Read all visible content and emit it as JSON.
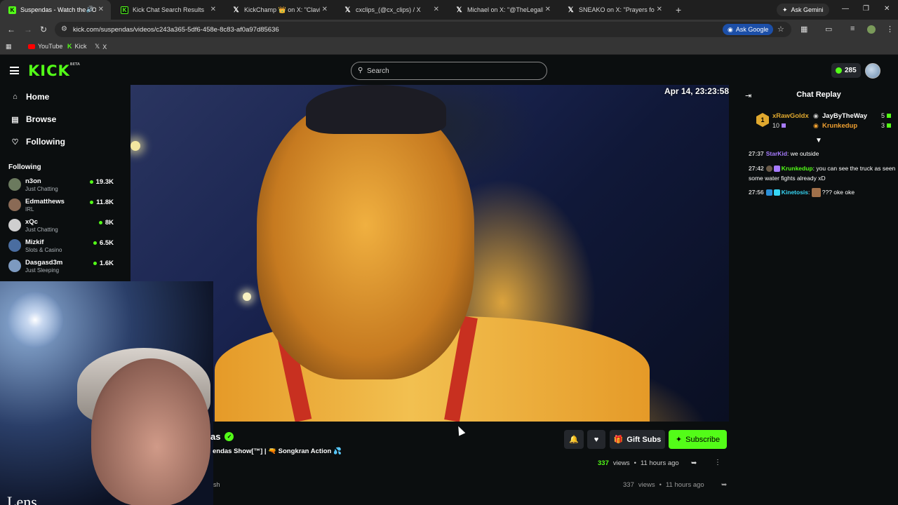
{
  "browser": {
    "tabs": [
      {
        "title": "Suspendas - Watch the VOD",
        "favicon": "kick",
        "active": true
      },
      {
        "title": "Kick Chat Search Results",
        "favicon": "kickdark",
        "active": false
      },
      {
        "title": "KickChamp 👑 on X: \"Clavicula...",
        "favicon": "x",
        "active": false
      },
      {
        "title": "cxclips_(@cx_clips) / X",
        "favicon": "x",
        "active": false
      },
      {
        "title": "Michael on X: \"@TheLegalMind...",
        "favicon": "x",
        "active": false
      },
      {
        "title": "SNEAKO on X: \"Prayers for Cla...",
        "favicon": "x",
        "active": false
      }
    ],
    "ask_gemini": "Ask Gemini",
    "url": "kick.com/suspendas/videos/c243a365-5df6-458e-8c83-af0a97d85636",
    "ask_google": "Ask Google",
    "bookmarks": [
      {
        "label": "YouTube",
        "icon": "youtube-icon"
      },
      {
        "label": "Kick",
        "icon": "kick-icon"
      },
      {
        "label": "X",
        "icon": "x-icon"
      }
    ]
  },
  "header": {
    "logo": "KICK",
    "logo_badge": "BETA",
    "search_placeholder": "Search",
    "points": "285"
  },
  "sidebar": {
    "nav": [
      {
        "label": "Home",
        "icon": "home-icon"
      },
      {
        "label": "Browse",
        "icon": "browse-icon"
      },
      {
        "label": "Following",
        "icon": "heart-icon"
      }
    ],
    "following_heading": "Following",
    "following": [
      {
        "name": "n3on",
        "category": "Just Chatting",
        "viewers": "19.3K",
        "avatar_color": "#6b7a5e"
      },
      {
        "name": "Edmatthews",
        "category": "IRL",
        "viewers": "11.8K",
        "avatar_color": "#8a6a55"
      },
      {
        "name": "xQc",
        "category": "Just Chatting",
        "viewers": "8K",
        "avatar_color": "#cfcfcf"
      },
      {
        "name": "Mizkif",
        "category": "Slots & Casino",
        "viewers": "6.5K",
        "avatar_color": "#4a6da0"
      },
      {
        "name": "Dasgasd3m",
        "category": "Just Sleeping",
        "viewers": "1.6K",
        "avatar_color": "#7d9ac0"
      }
    ]
  },
  "video": {
    "timestamp": "Apr 14, 23:23:58"
  },
  "webcam": {
    "caption": "Lens"
  },
  "stream_info": {
    "name_fragment": "as",
    "title": "endas Show[™] | 🔫 Songkran Action 💦",
    "faded_fragment": "sh",
    "gift_subs_label": "Gift Subs",
    "subscribe_label": "Subscribe",
    "views": "337",
    "views_label": "views",
    "time_ago": "11 hours ago"
  },
  "chat": {
    "title": "Chat Replay",
    "leaderboard": [
      {
        "rank": "1",
        "name": "xRawGoldx",
        "count": "10",
        "color": "#e0a82e"
      },
      {
        "name": "JayByTheWay",
        "count": "5",
        "color": "#ffffff"
      },
      {
        "name": "Krunkedup",
        "count": "3",
        "color": "#f0a030"
      }
    ],
    "messages": [
      {
        "time": "27:37",
        "user": "StarKid",
        "user_color": "#a77bff",
        "text": "we outside"
      },
      {
        "time": "27:42",
        "user": "Krunkedup",
        "user_color": "#53fc18",
        "text": "you can see the truck as seen some water fights already xD"
      },
      {
        "time": "27:56",
        "user": "Kinetosis",
        "user_color": "#37d6f5",
        "text": "??? oke oke"
      }
    ]
  },
  "colors": {
    "accent": "#53fc18",
    "background": "#0b0e0f",
    "button_bg": "#24272c"
  }
}
